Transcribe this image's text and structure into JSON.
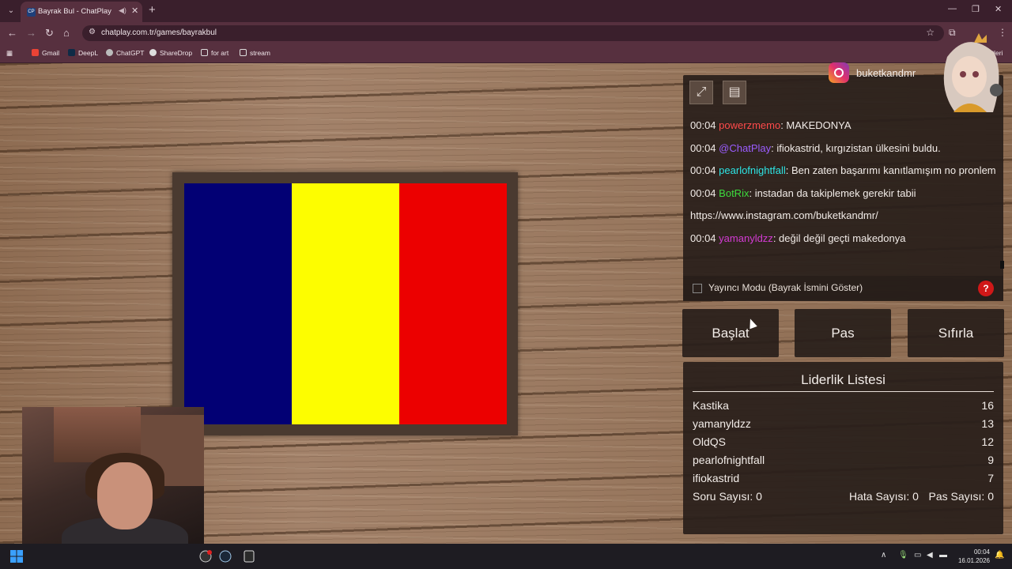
{
  "browser": {
    "tab_title": "Bayrak Bul - ChatPlay",
    "tab_favicon": "CP",
    "url": "chatplay.com.tr/games/bayrakbul",
    "bookmarks": [
      "Gmail",
      "DeepL",
      "ChatGPT",
      "ShareDrop",
      "for art",
      "stream"
    ],
    "extra_label": "etleri"
  },
  "game": {
    "flag_colors": [
      "#020074",
      "#fdfd00",
      "#ec0000"
    ],
    "instagram_handle": "buketkandmr",
    "chat": [
      {
        "time": "00:04",
        "user": "powerzmemo",
        "color": "#ff4b4b",
        "message": ": MAKEDONYA"
      },
      {
        "time": "00:04",
        "user": "@ChatPlay",
        "color": "#9b5cff",
        "message": ": ifiokastrid, kırgızistan ülkesini buldu."
      },
      {
        "time": "00:04",
        "user": "pearlofnightfall",
        "color": "#2de6e6",
        "message": ": Ben zaten başarımı kanıtlamışım no pronlem"
      },
      {
        "time": "00:04",
        "user": "BotRix",
        "color": "#3ddc3d",
        "message": ": instadan da takiplemek gerekir tabii https://www.instagram.com/buketkandmr/"
      },
      {
        "time": "00:04",
        "user": "yamanyldzz",
        "color": "#d43bd4",
        "message": ": değil değil geçti makedonya"
      }
    ],
    "streamer_mode_label": "Yayıncı Modu (Bayrak İsmini Göster)",
    "help_label": "?",
    "buttons": {
      "start": "Başlat",
      "pass": "Pas",
      "reset": "Sıfırla"
    },
    "leaderboard": {
      "title": "Liderlik Listesi",
      "entries": [
        {
          "name": "Kastika",
          "score": "16"
        },
        {
          "name": "yamanyldzz",
          "score": "13"
        },
        {
          "name": "OldQS",
          "score": "12"
        },
        {
          "name": "pearlofnightfall",
          "score": "9"
        },
        {
          "name": "ifiokastrid",
          "score": "7"
        }
      ],
      "question_count": "Soru Sayısı: 0",
      "error_count": "Hata Sayısı: 0",
      "pass_count": "Pas Sayısı: 0"
    }
  },
  "taskbar": {
    "time": "00:04",
    "date": "16.01.2026"
  }
}
